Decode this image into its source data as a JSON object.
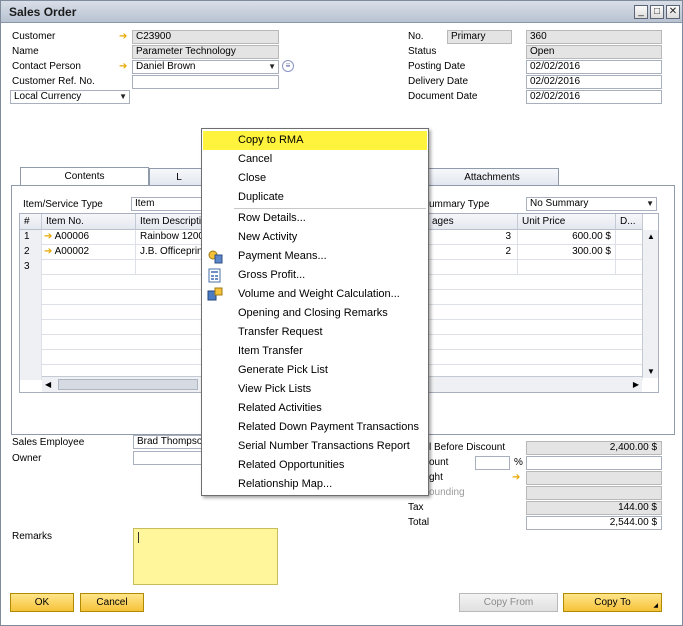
{
  "window": {
    "title": "Sales Order"
  },
  "header_left": {
    "customer_label": "Customer",
    "customer_value": "C23900",
    "name_label": "Name",
    "name_value": "Parameter Technology",
    "contact_label": "Contact Person",
    "contact_value": "Daniel Brown",
    "custref_label": "Customer Ref. No.",
    "custref_value": "",
    "currency_value": "Local Currency"
  },
  "header_right": {
    "no_label": "No.",
    "no_series": "Primary",
    "no_value": "360",
    "status_label": "Status",
    "status_value": "Open",
    "posting_label": "Posting Date",
    "posting_value": "02/02/2016",
    "delivery_label": "Delivery Date",
    "delivery_value": "02/02/2016",
    "document_label": "Document Date",
    "document_value": "02/02/2016"
  },
  "tabs": [
    {
      "label": "Contents"
    },
    {
      "label": "L"
    },
    {
      "label": "Attachments"
    }
  ],
  "contents": {
    "item_type_label": "Item/Service Type",
    "item_type_value": "Item",
    "summary_label": "ummary Type",
    "summary_value": "No Summary",
    "columns": {
      "rownum": "#",
      "item_no": "Item No.",
      "item_desc": "Item Descripti",
      "packages": "ages",
      "unit_price": "Unit Price",
      "d": "D..."
    },
    "rows": [
      {
        "num": "1",
        "item_no": "A00006",
        "desc": "Rainbow 1200",
        "qty": "3",
        "price": "600.00 $"
      },
      {
        "num": "2",
        "item_no": "A00002",
        "desc": "J.B. Officeprin",
        "qty": "2",
        "price": "300.00 $"
      },
      {
        "num": "3",
        "item_no": "",
        "desc": "",
        "qty": "",
        "price": ""
      }
    ]
  },
  "footer_left": {
    "sales_employee_label": "Sales Employee",
    "sales_employee_value": "Brad Thompso",
    "owner_label": "Owner",
    "owner_value": "",
    "remarks_label": "Remarks",
    "remarks_value": ""
  },
  "totals": {
    "before_discount_label": "l Before Discount",
    "before_discount_value": "2,400.00 $",
    "discount_label": "ount",
    "discount_pct_symbol": "%",
    "freight_label": "ght",
    "rounding_label": "ounding",
    "tax_label": "Tax",
    "tax_value": "144.00 $",
    "total_label": "Total",
    "total_value": "2,544.00 $"
  },
  "buttons": {
    "ok": "OK",
    "cancel": "Cancel",
    "copy_from": "Copy From",
    "copy_to": "Copy To"
  },
  "context_menu": {
    "items": [
      {
        "label": "Copy to RMA",
        "highlighted": true
      },
      {
        "label": "Cancel"
      },
      {
        "label": "Close"
      },
      {
        "label": "Duplicate"
      },
      {
        "label": "Row Details..."
      },
      {
        "label": "New Activity"
      },
      {
        "label": "Payment Means...",
        "icon": "payment-icon"
      },
      {
        "label": "Gross Profit...",
        "icon": "gross-profit-icon"
      },
      {
        "label": "Volume and Weight Calculation...",
        "icon": "volume-weight-icon"
      },
      {
        "label": "Opening and Closing Remarks"
      },
      {
        "label": "Transfer Request"
      },
      {
        "label": "Item Transfer"
      },
      {
        "label": "Generate Pick List"
      },
      {
        "label": "View Pick Lists"
      },
      {
        "label": "Related Activities"
      },
      {
        "label": "Related Down Payment Transactions"
      },
      {
        "label": "Serial Number Transactions Report"
      },
      {
        "label": "Related Opportunities"
      },
      {
        "label": "Relationship Map..."
      }
    ]
  },
  "colors": {
    "highlight": "#fff33d",
    "button": "#f6c23a",
    "remarks_bg": "#fff59a",
    "link_arrow": "#e7a800"
  }
}
